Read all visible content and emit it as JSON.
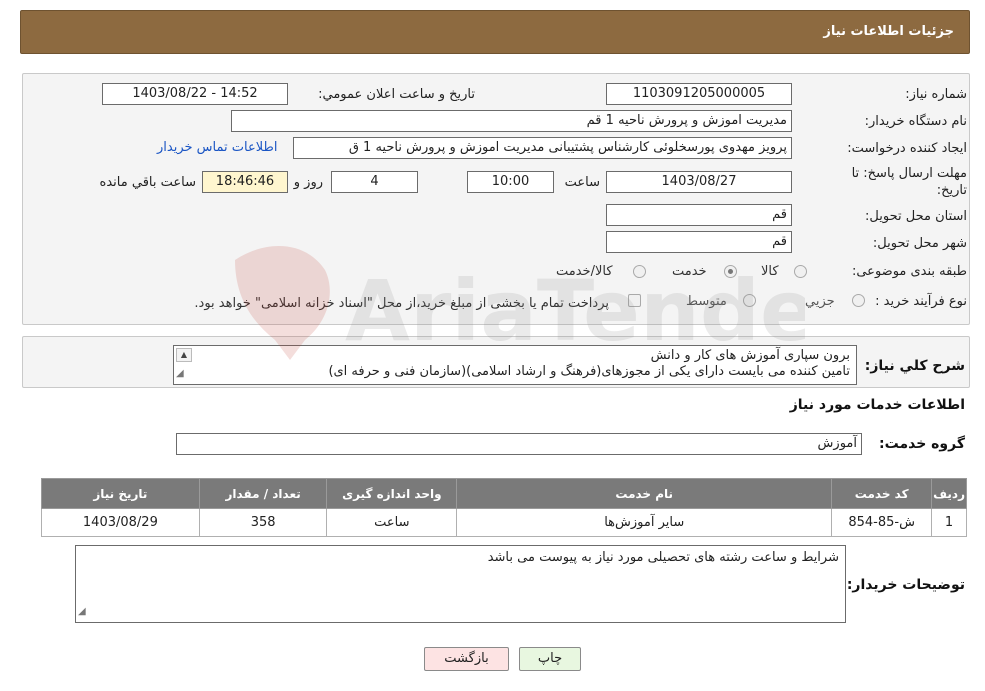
{
  "header": {
    "title": "جزئیات اطلاعات نیاز"
  },
  "need_number": {
    "label": "شماره نیاز:",
    "value": "1103091205000005"
  },
  "announce_datetime": {
    "label": "تاریخ و ساعت اعلان عمومي:",
    "value": "1403/08/22 - 14:52"
  },
  "buyer_org": {
    "label": "نام دستگاه خريدار:",
    "value": "مديريت اموزش و پرورش ناحيه 1 قم"
  },
  "requester": {
    "label": "ايجاد کننده درخواست:",
    "value": "پرويز مهدوی پورسخلوئی کارشناس پشتيبانی مديريت اموزش و پرورش ناحيه 1 ق",
    "contact_link": "اطلاعات تماس خريدار"
  },
  "deadline": {
    "label_line1": "مهلت ارسال پاسخ: تا",
    "label_line2": "تاريخ:",
    "date": "1403/08/27",
    "time_label": "ساعت",
    "time": "10:00",
    "days": "4",
    "days_label": "روز و",
    "remaining": "18:46:46",
    "remaining_label": "ساعت باقي مانده"
  },
  "province": {
    "label": "استان محل تحويل:",
    "value": "قم"
  },
  "city": {
    "label": "شهر محل تحويل:",
    "value": "قم"
  },
  "category": {
    "label": "طبقه بندی موضوعی:",
    "options": [
      "کالا",
      "خدمت",
      "کالا/خدمت"
    ],
    "selected": "خدمت"
  },
  "purchase_type": {
    "label": "نوع فرآيند خريد :",
    "options": [
      "جزيي",
      "متوسط"
    ],
    "note": "پرداخت تمام یا بخشی از مبلغ خرید،از محل \"اسناد خزانه اسلامی\" خواهد بود."
  },
  "description": {
    "label": "شرح کلي نياز:",
    "line1": "برون سپاری آموزش های کار و دانش",
    "line2": "تامین کننده می بایست دارای یکی از مجوزهای(فرهنگ و ارشاد اسلامی)(سازمان فنی و حرفه ای)"
  },
  "services_section": {
    "title": "اطلاعات خدمات مورد نياز"
  },
  "service_group": {
    "label": "گروه خدمت:",
    "value": "آموزش"
  },
  "table": {
    "headers": [
      "رديف",
      "کد خدمت",
      "نام خدمت",
      "واحد اندازه گيری",
      "تعداد / مقدار",
      "تاريخ نياز"
    ],
    "rows": [
      [
        "1",
        "ش-85-854",
        "ساير آموزش‌ها",
        "ساعت",
        "358",
        "1403/08/29"
      ]
    ]
  },
  "buyer_notes": {
    "label": "توضيحات خريدار:",
    "value": "شرايط و ساعت رشته های تحصيلی مورد نياز به پيوست می باشد"
  },
  "buttons": {
    "print": "چاپ",
    "back": "بازگشت"
  },
  "colors": {
    "header_bg": "#8d6a40",
    "table_header_bg": "#7a7a7a",
    "back_button_bg": "#fde3e3",
    "print_button_bg": "#e8f7e0"
  }
}
